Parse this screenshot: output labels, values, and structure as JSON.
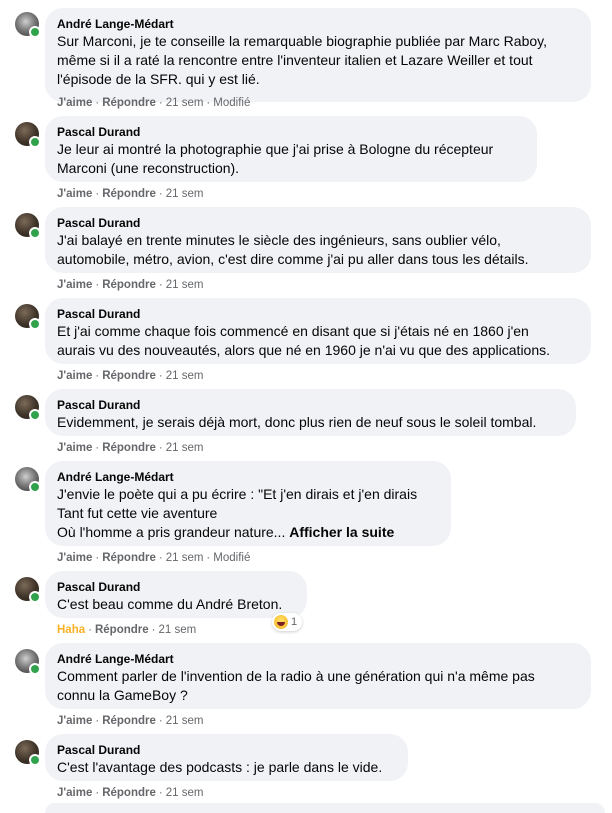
{
  "comments": [
    {
      "author": "André Lange-Médart",
      "text": "Sur Marconi, je te conseille la remarquable biographie publiée par Marc Raboy,\nmême si il a raté la rencontre entre l'inventeur italien et Lazare Weiller et tout\nl'épisode de la SFR. qui y est lié.",
      "like": "J'aime",
      "reply": "Répondre",
      "time": "21 sem",
      "edited": "Modifié"
    },
    {
      "author": "Pascal Durand",
      "text": "Je leur ai montré la photographie que j'ai prise à Bologne du récepteur\nMarconi (une reconstruction).",
      "like": "J'aime",
      "reply": "Répondre",
      "time": "21 sem"
    },
    {
      "author": "Pascal Durand",
      "text": "J'ai balayé en trente minutes le siècle des ingénieurs, sans oublier vélo,\nautomobile, métro, avion, c'est dire comme j'ai pu aller dans tous les détails.",
      "like": "J'aime",
      "reply": "Répondre",
      "time": "21 sem"
    },
    {
      "author": "Pascal Durand",
      "text": "Et j'ai comme chaque fois commencé en disant que si j'étais né en 1860 j'en\naurais vu des nouveautés, alors que né en 1960 je n'ai vu que des applications.",
      "like": "J'aime",
      "reply": "Répondre",
      "time": "21 sem"
    },
    {
      "author": "Pascal Durand",
      "text": "Evidemment, je serais déjà mort, donc plus rien de neuf sous le soleil tombal.",
      "like": "J'aime",
      "reply": "Répondre",
      "time": "21 sem"
    },
    {
      "author": "André Lange-Médart",
      "text": "J'envie le poète qui a pu écrire : \"Et j'en dirais et j'en dirais\nTant fut cette vie aventure\nOù l'homme a pris grandeur nature...",
      "see_more": "Afficher la suite",
      "like": "J'aime",
      "reply": "Répondre",
      "time": "21 sem",
      "edited": "Modifié"
    },
    {
      "author": "Pascal Durand",
      "text": "C'est beau comme du André Breton.",
      "reaction_label": "Haha",
      "reaction_count": "1",
      "reply": "Répondre",
      "time": "21 sem"
    },
    {
      "author": "André Lange-Médart",
      "text": "Comment parler de l'invention de la radio à une génération qui n'a même pas\nconnu la GameBoy ?",
      "like": "J'aime",
      "reply": "Répondre",
      "time": "21 sem"
    },
    {
      "author": "Pascal Durand",
      "text": "C'est l'avantage des podcasts : je parle dans le vide.",
      "like": "J'aime",
      "reply": "Répondre",
      "time": "21 sem"
    }
  ],
  "separator": "·",
  "colors": {
    "bubble": "#f0f2f5",
    "meta": "#65676b",
    "online": "#31a24c",
    "haha": "#f7b125"
  }
}
